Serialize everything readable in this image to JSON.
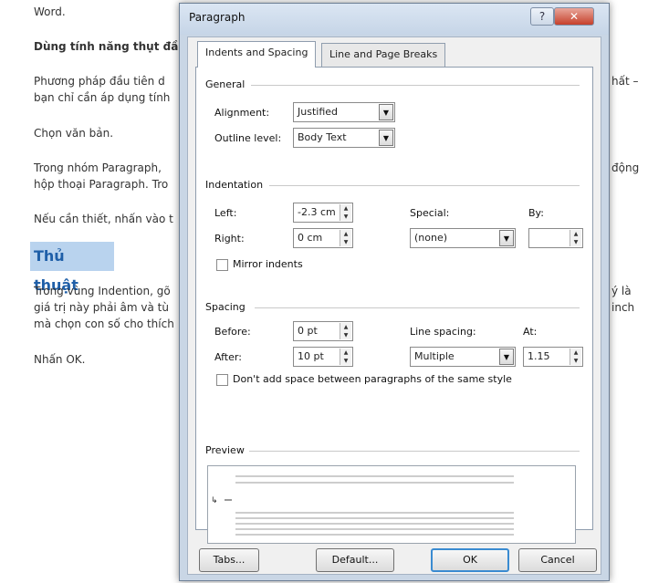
{
  "article": {
    "lines": [
      "Word.",
      "Dùng tính năng thụt đầ",
      "Phương pháp đầu tiên d",
      "bạn chỉ cần áp dụng tính",
      "Chọn văn bản.",
      "Trong nhóm Paragraph,",
      "hộp thoại Paragraph. Tro",
      "Nếu cần thiết, nhấn vào t",
      "Trong vùng Indention, gõ",
      "giá trị này phải âm và tù",
      "mà chọn con số cho thích",
      "Nhấn OK."
    ],
    "heading": "Thủ thuật",
    "right_fragments": [
      "hất –",
      "động",
      "ý là",
      "inch"
    ]
  },
  "dialog": {
    "title": "Paragraph",
    "help_label": "?",
    "close_label": "✕",
    "tabs": [
      "Indents and Spacing",
      "Line and Page Breaks"
    ],
    "general": {
      "title": "General",
      "alignment_label": "Alignment:",
      "alignment_value": "Justified",
      "outline_label": "Outline level:",
      "outline_value": "Body Text"
    },
    "indentation": {
      "title": "Indentation",
      "left_label": "Left:",
      "left_value": "-2.3 cm",
      "right_label": "Right:",
      "right_value": "0 cm",
      "special_label": "Special:",
      "special_value": "(none)",
      "by_label": "By:",
      "by_value": "",
      "mirror_label": "Mirror indents"
    },
    "spacing": {
      "title": "Spacing",
      "before_label": "Before:",
      "before_value": "0 pt",
      "after_label": "After:",
      "after_value": "10 pt",
      "line_spacing_label": "Line spacing:",
      "line_spacing_value": "Multiple",
      "at_label": "At:",
      "at_value": "1.15",
      "dont_add_label": "Don't add space between paragraphs of the same style"
    },
    "preview": {
      "title": "Preview"
    },
    "buttons": {
      "tabs": "Tabs...",
      "default": "Default...",
      "ok": "OK",
      "cancel": "Cancel"
    }
  }
}
